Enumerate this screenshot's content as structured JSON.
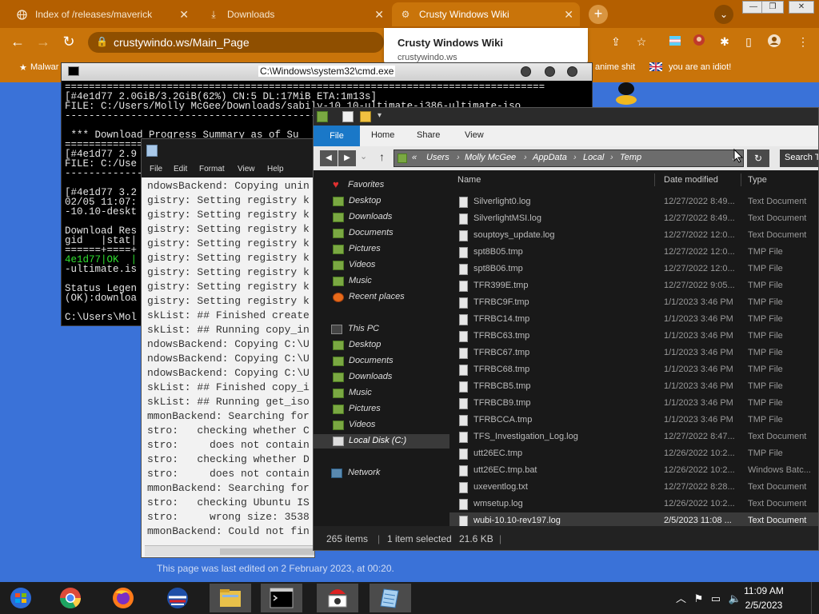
{
  "browser": {
    "tabs": [
      {
        "label": "Index of /releases/maverick",
        "icon": "globe-icon"
      },
      {
        "label": "Downloads",
        "icon": "download-icon"
      },
      {
        "label": "Crusty Windows Wiki",
        "icon": "gear-icon"
      }
    ],
    "url": "crustywindo.ws/Main_Page",
    "bookmarks": [
      "Malwar",
      "anime shit",
      "you are an idiot!"
    ],
    "tooltip": {
      "title": "Crusty Windows Wiki",
      "url": "crustywindo.ws"
    },
    "footer": "This page was last edited on 2 February 2023, at 00:20."
  },
  "cmd": {
    "title": "C:\\Windows\\system32\\cmd.exe",
    "lines": [
      "================================================================================",
      "[#4e1d77 2.0GiB/3.2GiB(62%) CN:5 DL:17MiB ETA:1m13s]",
      "FILE: C:/Users/Molly McGee/Downloads/sabily-10.10-ultimate-i386-ultimate-iso",
      "--------------------------------------------------------------------------------",
      "",
      " *** Download Progress Summary as of Su",
      "================================================================================",
      "[#4e1d77 2.9",
      "FILE: C:/Use",
      "--------------------------------------------------------------------------------",
      "",
      "[#4e1d77 3.2",
      "02/05 11:07:",
      "-10.10-deskt",
      "",
      "Download Res",
      "gid   |stat|",
      "======+====+",
      "4e1d77|OK  |",
      "-ultimate.is",
      "",
      "Status Legen",
      "(OK):downloa",
      "",
      "C:\\Users\\Mol"
    ]
  },
  "notepad": {
    "menu": [
      "File",
      "Edit",
      "Format",
      "View",
      "Help"
    ],
    "lines": [
      "ndowsBackend: Copying unin",
      "gistry: Setting registry k",
      "gistry: Setting registry k",
      "gistry: Setting registry k",
      "gistry: Setting registry k",
      "gistry: Setting registry k",
      "gistry: Setting registry k",
      "gistry: Setting registry k",
      "gistry: Setting registry k",
      "skList: ## Finished create",
      "skList: ## Running copy_in",
      "ndowsBackend: Copying C:\\U",
      "ndowsBackend: Copying C:\\U",
      "ndowsBackend: Copying C:\\U",
      "skList: ## Finished copy_i",
      "skList: ## Running get_iso",
      "mmonBackend: Searching for",
      "stro:   checking whether C",
      "stro:     does not contain",
      "stro:   checking whether D",
      "stro:     does not contain",
      "mmonBackend: Searching for",
      "stro:   checking Ubuntu IS",
      "stro:     wrong size: 3538",
      "mmonBackend: Could not fin"
    ]
  },
  "explorer": {
    "ribbon": {
      "file": "File",
      "tabs": [
        "Home",
        "Share",
        "View"
      ]
    },
    "breadcrumb": [
      "«",
      "Users",
      "Molly McGee",
      "AppData",
      "Local",
      "Temp"
    ],
    "search": "Search T",
    "nav": {
      "favorites": "Favorites",
      "fav_items": [
        "Desktop",
        "Downloads",
        "Documents",
        "Pictures",
        "Videos",
        "Music",
        "Recent places"
      ],
      "thispc": "This PC",
      "pc_items": [
        "Desktop",
        "Documents",
        "Downloads",
        "Music",
        "Pictures",
        "Videos",
        "Local Disk (C:)"
      ],
      "network": "Network"
    },
    "columns": {
      "name": "Name",
      "date": "Date modified",
      "type": "Type"
    },
    "files": [
      {
        "name": "Silverlight0.log",
        "date": "12/27/2022 8:49...",
        "type": "Text Document"
      },
      {
        "name": "SilverlightMSI.log",
        "date": "12/27/2022 8:49...",
        "type": "Text Document"
      },
      {
        "name": "souptoys_update.log",
        "date": "12/27/2022 12:0...",
        "type": "Text Document"
      },
      {
        "name": "spt8B05.tmp",
        "date": "12/27/2022 12:0...",
        "type": "TMP File"
      },
      {
        "name": "spt8B06.tmp",
        "date": "12/27/2022 12:0...",
        "type": "TMP File"
      },
      {
        "name": "TFR399E.tmp",
        "date": "12/27/2022 9:05...",
        "type": "TMP File"
      },
      {
        "name": "TFRBC9F.tmp",
        "date": "1/1/2023 3:46 PM",
        "type": "TMP File"
      },
      {
        "name": "TFRBC14.tmp",
        "date": "1/1/2023 3:46 PM",
        "type": "TMP File"
      },
      {
        "name": "TFRBC63.tmp",
        "date": "1/1/2023 3:46 PM",
        "type": "TMP File"
      },
      {
        "name": "TFRBC67.tmp",
        "date": "1/1/2023 3:46 PM",
        "type": "TMP File"
      },
      {
        "name": "TFRBC68.tmp",
        "date": "1/1/2023 3:46 PM",
        "type": "TMP File"
      },
      {
        "name": "TFRBCB5.tmp",
        "date": "1/1/2023 3:46 PM",
        "type": "TMP File"
      },
      {
        "name": "TFRBCB9.tmp",
        "date": "1/1/2023 3:46 PM",
        "type": "TMP File"
      },
      {
        "name": "TFRBCCA.tmp",
        "date": "1/1/2023 3:46 PM",
        "type": "TMP File"
      },
      {
        "name": "TFS_Investigation_Log.log",
        "date": "12/27/2022 8:47...",
        "type": "Text Document"
      },
      {
        "name": "utt26EC.tmp",
        "date": "12/26/2022 10:2...",
        "type": "TMP File"
      },
      {
        "name": "utt26EC.tmp.bat",
        "date": "12/26/2022 10:2...",
        "type": "Windows Batc..."
      },
      {
        "name": "uxeventlog.txt",
        "date": "12/27/2022 8:28...",
        "type": "Text Document"
      },
      {
        "name": "wmsetup.log",
        "date": "12/26/2022 10:2...",
        "type": "Text Document"
      },
      {
        "name": "wubi-10.10-rev197.log",
        "date": "2/5/2023 11:08 ...",
        "type": "Text Document"
      }
    ],
    "status": {
      "items": "265 items",
      "selected": "1 item selected",
      "size": "21.6 KB"
    }
  },
  "taskbar": {
    "apps": [
      "start-button",
      "chrome-icon",
      "firefox-icon",
      "vote-app-icon",
      "file-explorer-icon",
      "cmd-icon",
      "java-icon",
      "notepad-icon"
    ],
    "time": "11:09 AM",
    "date": "2/5/2023"
  }
}
